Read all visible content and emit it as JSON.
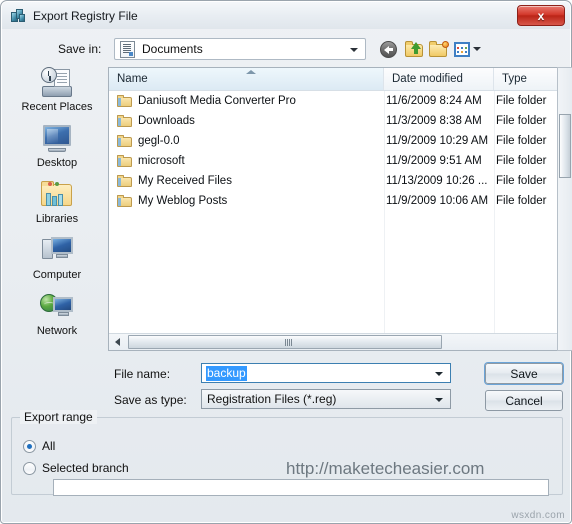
{
  "window": {
    "title": "Export Registry File",
    "icon": "registry-editor-icon",
    "close_label": "x"
  },
  "savein": {
    "label": "Save in:",
    "value": "Documents",
    "icon": "documents-icon"
  },
  "toolbar": {
    "back": "back-icon",
    "up": "up-one-level-icon",
    "new_folder": "new-folder-icon",
    "views": "views-icon"
  },
  "places": [
    {
      "label": "Recent Places",
      "icon": "recent-places-icon"
    },
    {
      "label": "Desktop",
      "icon": "desktop-icon"
    },
    {
      "label": "Libraries",
      "icon": "libraries-icon"
    },
    {
      "label": "Computer",
      "icon": "computer-icon"
    },
    {
      "label": "Network",
      "icon": "network-icon"
    }
  ],
  "filelist": {
    "columns": [
      "Name",
      "Date modified",
      "Type"
    ],
    "sort_column": "Name",
    "sort_direction": "ascending",
    "rows": [
      {
        "name": "Daniusoft Media Converter Pro",
        "date": "11/6/2009 8:24 AM",
        "type": "File folder"
      },
      {
        "name": "Downloads",
        "date": "11/3/2009 8:38 AM",
        "type": "File folder"
      },
      {
        "name": "gegl-0.0",
        "date": "11/9/2009 10:29 AM",
        "type": "File folder"
      },
      {
        "name": "microsoft",
        "date": "11/9/2009 9:51 AM",
        "type": "File folder"
      },
      {
        "name": "My Received Files",
        "date": "11/13/2009 10:26 ...",
        "type": "File folder"
      },
      {
        "name": "My Weblog Posts",
        "date": "11/9/2009 10:06 AM",
        "type": "File folder"
      }
    ]
  },
  "filename": {
    "label": "File name:",
    "value": "backup"
  },
  "filetype": {
    "label": "Save as type:",
    "value": "Registration Files (*.reg)"
  },
  "buttons": {
    "save": "Save",
    "cancel": "Cancel"
  },
  "export_range": {
    "group_label": "Export range",
    "options": [
      {
        "label": "All",
        "selected": true
      },
      {
        "label": "Selected branch",
        "selected": false
      }
    ],
    "branch_value": ""
  },
  "watermarks": {
    "url": "http://maketecheasier.com",
    "corner": "wsxdn.com"
  },
  "colors": {
    "accent": "#3399ff",
    "close_red": "#d4392c",
    "focus_blue": "#6ba4d8",
    "folder_yellow": "#eccd7c"
  }
}
